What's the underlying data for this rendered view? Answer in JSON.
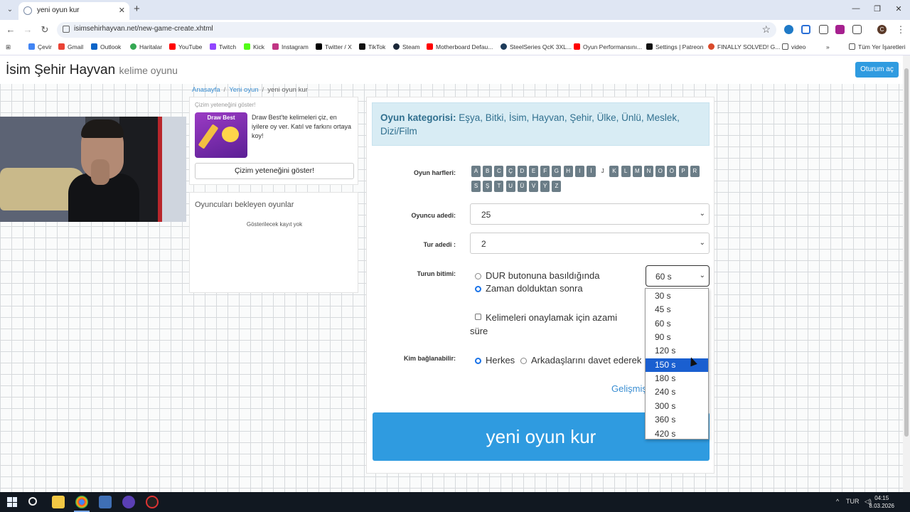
{
  "browser": {
    "tab_title": "yeni oyun kur",
    "url": "isimsehirhayvan.net/new-game-create.xhtml",
    "bookmarks": [
      "Çevir",
      "Gmail",
      "Outlook",
      "Haritalar",
      "YouTube",
      "Twitch",
      "Kick",
      "Instagram",
      "Twitter / X",
      "TikTok",
      "Steam",
      "Motherboard Defau...",
      "SteelSeries QcK 3XL...",
      "Oyun Performansını...",
      "Settings | Patreon",
      "FINALLY SOLVED! G...",
      "video"
    ],
    "all_bookmarks": "Tüm Yer İşaretleri",
    "profile_initial": "C",
    "colors": {
      "tabbar": "#dfe6f3",
      "accent": "#2f9be0"
    }
  },
  "header": {
    "brand": "İsim Şehir Hayvan",
    "brand_sub": "kelime oyunu",
    "login": "Oturum aç"
  },
  "breadcrumb": {
    "home": "Anasayfa",
    "new_game": "Yeni oyun",
    "current": "yeni oyun kur"
  },
  "draw_card": {
    "title": "Çizim yeteneğini göster!",
    "image_label": "Draw Best",
    "text": "Draw Best'te kelimeleri çiz, en iyilere oy ver. Katıl ve farkını ortaya koy!",
    "button": "Çizim yeteneğini göster!"
  },
  "waiting": {
    "title": "Oyuncuları bekleyen oyunlar",
    "empty": "Gösterilecek kayıt yok"
  },
  "form": {
    "category_label": "Oyun kategorisi:",
    "category_values": "Eşya, Bitki, İsim, Hayvan, Şehir, Ülke, Ünlü, Meslek, Dizi/Film",
    "letters_label": "Oyun harfleri:",
    "letters": [
      "A",
      "B",
      "C",
      "Ç",
      "D",
      "E",
      "F",
      "G",
      "H",
      "I",
      "İ",
      "J",
      "K",
      "L",
      "M",
      "N",
      "O",
      "Ö",
      "P",
      "R",
      "S",
      "Ş",
      "T",
      "U",
      "Ü",
      "V",
      "Y",
      "Z"
    ],
    "disabled_letters": [
      "J"
    ],
    "players_label": "Oyuncu adedi:",
    "players_value": "25",
    "rounds_label": "Tur adedi :",
    "rounds_value": "2",
    "round_end_label": "Turun bitimi:",
    "round_end_options": [
      "DUR butonuna basıldığında",
      "Zaman dolduktan sonra"
    ],
    "round_end_selected": 1,
    "time_value": "60 s",
    "time_options": [
      "30 s",
      "45 s",
      "60 s",
      "90 s",
      "120 s",
      "150 s",
      "180 s",
      "240 s",
      "300 s",
      "360 s",
      "420 s"
    ],
    "time_highlighted": "150 s",
    "confirm_label": "Kelimeleri onaylamak için azami süre",
    "who_label": "Kim bağlanabilir:",
    "who_options": [
      "Herkes",
      "Arkadaşlarını davet ederek"
    ],
    "who_selected": 0,
    "advanced": "Gelişmiş",
    "create": "yeni oyun kur"
  },
  "taskbar": {
    "time": "04:15",
    "date": "8.03.2026",
    "lang": "TUR"
  }
}
